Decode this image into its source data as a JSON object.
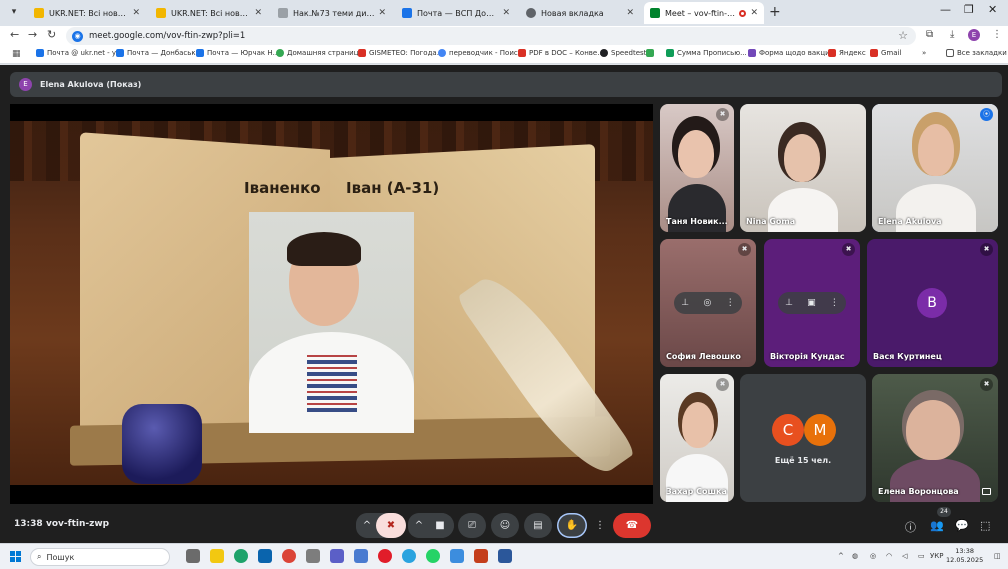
{
  "browser": {
    "tabs": [
      {
        "label": "UKR.NET: Всі новини України,",
        "favicon_color": "#f2b600",
        "active": false
      },
      {
        "label": "UKR.NET: Всі новини України,",
        "favicon_color": "#f2b600",
        "active": false
      },
      {
        "label": "Нак.№73 теми дипл. проектів",
        "favicon_color": "#9aa0a6",
        "active": false
      },
      {
        "label": "Почта — ВСП Донбаський агр",
        "favicon_color": "#1a73e8",
        "active": false
      },
      {
        "label": "Новая вкладка",
        "favicon_color": "#5f6368",
        "active": false
      },
      {
        "label": "Meet – vov-ftin-zwp",
        "favicon_color": "#00832d",
        "active": true
      }
    ],
    "url": "meet.google.com/vov-ftin-zwp?pli=1",
    "profile_initial": "E",
    "bookmarks": [
      {
        "label": "Почта @ ukr.net - у...",
        "color": "#1a73e8"
      },
      {
        "label": "Почта — Донбаськ...",
        "color": "#1a73e8"
      },
      {
        "label": "Почта — Юрчак Н...",
        "color": "#1a73e8"
      },
      {
        "label": "Домашняя страниц...",
        "color": "#34a853"
      },
      {
        "label": "GISMETEO: Погода...",
        "color": "#d93025"
      },
      {
        "label": "переводчик - Поис...",
        "color": "#4285f4"
      },
      {
        "label": "PDF в DOC – Конве...",
        "color": "#d93025"
      },
      {
        "label": "Speedtest",
        "color": "#202124"
      },
      {
        "label": "",
        "color": "#34a853"
      },
      {
        "label": "Сумма Прописью...",
        "color": "#0f9d58"
      },
      {
        "label": "Форма щодо вакци...",
        "color": "#7248b9"
      },
      {
        "label": "Яндекс",
        "color": "#d93025"
      },
      {
        "label": "Gmail",
        "color": "#d93025"
      }
    ],
    "all_bookmarks": "Все закладки"
  },
  "meet": {
    "presenter": {
      "initial": "E",
      "name": "Elena Akulova (Показ)"
    },
    "shared_screen": {
      "name_left": "Іваненко",
      "name_right": "Іван (А-31)"
    },
    "tiles": [
      {
        "name": "Таня Новик...",
        "kind": "video",
        "muted": true
      },
      {
        "name": "Nina Goma",
        "kind": "video",
        "muted": false
      },
      {
        "name": "Elena Akulova",
        "kind": "video",
        "muted": false,
        "speaking": true
      },
      {
        "name": "София Левошко",
        "kind": "overlay",
        "muted": true
      },
      {
        "name": "Вікторія Кундас",
        "kind": "overlay",
        "muted": true
      },
      {
        "name": "Вася Куртинец",
        "kind": "avatar",
        "initial": "B",
        "color": "#7b2ca8",
        "muted": true
      },
      {
        "name": "Захар Сошка",
        "kind": "video",
        "muted": true
      },
      {
        "name": "Ещё 15 чел.",
        "kind": "more",
        "initials": [
          "C",
          "M"
        ],
        "colors": [
          "#e8501f",
          "#e8710a"
        ]
      },
      {
        "name": "Елена Воронцова",
        "kind": "video",
        "muted": true
      }
    ],
    "controls": {
      "time": "13:38",
      "meeting_code": "vov-ftin-zwp",
      "participant_count": "24"
    }
  },
  "taskbar": {
    "search_placeholder": "Пошук",
    "language": "УКР",
    "time": "13:38",
    "date": "12.05.2025"
  }
}
